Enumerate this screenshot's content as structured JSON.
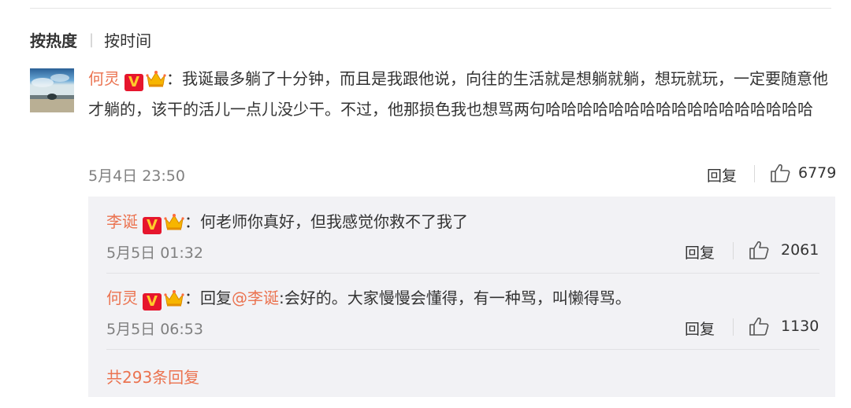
{
  "sort": {
    "hot": "按热度",
    "time": "按时间"
  },
  "comment": {
    "author": "何灵",
    "vip_badge": "V",
    "colon": "：",
    "text": "我诞最多躺了十分钟，而且是我跟他说，向往的生活就是想躺就躺，想玩就玩，一定要随意他才躺的，该干的活儿一点儿没少干。不过，他那损色我也想骂两句哈哈哈哈哈哈哈哈哈哈哈哈哈哈哈哈哈",
    "time": "5月4日 23:50",
    "reply_label": "回复",
    "likes": "6779"
  },
  "replies": [
    {
      "author": "李诞",
      "vip_badge": "V",
      "colon": "：",
      "text": "何老师你真好，但我感觉你救不了我了",
      "time": "5月5日 01:32",
      "reply_label": "回复",
      "likes": "2061"
    },
    {
      "author": "何灵",
      "vip_badge": "V",
      "colon": "：",
      "prefix": "回复",
      "mention": "@李诞",
      "text": ":会好的。大家慢慢会懂得，有一种骂，叫懒得骂。",
      "time": "5月5日 06:53",
      "reply_label": "回复",
      "likes": "1130"
    }
  ],
  "more_replies": "共293条回复",
  "colors": {
    "username": "#eb7350",
    "vip": "#e6162d",
    "reply_bg": "#f2f2f5"
  },
  "icons": {
    "like": "thumbs-up-icon",
    "crown": "crown-icon",
    "vip": "vip-badge-icon"
  }
}
